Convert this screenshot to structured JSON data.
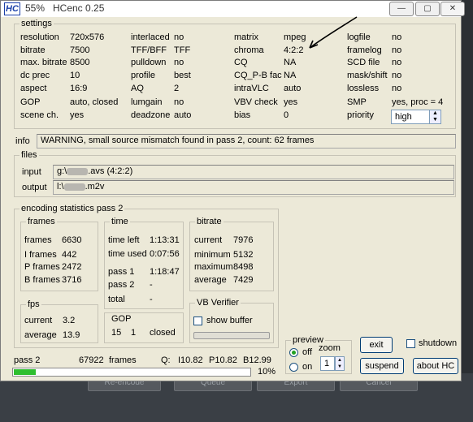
{
  "window": {
    "logo": "HC",
    "progress_title": "55%",
    "app_title": "HCenc 0.25",
    "buttons": {
      "minimize": "—",
      "maximize": "▢",
      "close": "✕"
    }
  },
  "taskbar": {
    "items": [
      "Re-encode",
      "Queue",
      "Export",
      "Cancel"
    ]
  },
  "settings": {
    "legend": "settings",
    "col1": [
      {
        "label": "resolution",
        "value": "720x576"
      },
      {
        "label": "bitrate",
        "value": "7500"
      },
      {
        "label": "max. bitrate",
        "value": "8500"
      },
      {
        "label": "dc prec",
        "value": "10"
      },
      {
        "label": "aspect",
        "value": "16:9"
      },
      {
        "label": "GOP",
        "value": "auto, closed"
      },
      {
        "label": "scene ch.",
        "value": "yes"
      }
    ],
    "col2": [
      {
        "label": "interlaced",
        "value": "no"
      },
      {
        "label": "TFF/BFF",
        "value": "TFF"
      },
      {
        "label": "pulldown",
        "value": "no"
      },
      {
        "label": "profile",
        "value": "best"
      },
      {
        "label": "AQ",
        "value": "2"
      },
      {
        "label": "lumgain",
        "value": "no"
      },
      {
        "label": "deadzone",
        "value": "auto"
      }
    ],
    "col3": [
      {
        "label": "matrix",
        "value": "mpeg"
      },
      {
        "label": "chroma",
        "value": "4:2:2"
      },
      {
        "label": "CQ",
        "value": "NA"
      },
      {
        "label": "CQ_P-B fac",
        "value": "NA"
      },
      {
        "label": "intraVLC",
        "value": "auto"
      },
      {
        "label": "VBV check",
        "value": "yes"
      },
      {
        "label": "bias",
        "value": "0"
      }
    ],
    "col4": [
      {
        "label": "logfile",
        "value": "no"
      },
      {
        "label": "framelog",
        "value": "no"
      },
      {
        "label": "SCD file",
        "value": "no"
      },
      {
        "label": "mask/shift",
        "value": "no"
      },
      {
        "label": "lossless",
        "value": "no"
      },
      {
        "label": "SMP",
        "value": "yes,  proc = 4"
      },
      {
        "label": "priority",
        "value": "high"
      }
    ]
  },
  "info": {
    "label": "info",
    "message": "WARNING, small source mismatch found in pass 2,  count: 62 frames"
  },
  "files": {
    "legend": "files",
    "input_label": "input",
    "input_prefix": "g:\\",
    "input_suffix": ".avs  (4:2:2)",
    "output_label": "output",
    "output_prefix": "l:\\",
    "output_suffix": ".m2v"
  },
  "stats": {
    "legend": "encoding statistics pass 2",
    "frames": {
      "legend": "frames",
      "rows": [
        {
          "label": "frames",
          "value": "6630"
        },
        {
          "label": "I frames",
          "value": "442"
        },
        {
          "label": "P frames",
          "value": "2472"
        },
        {
          "label": "B frames",
          "value": "3716"
        }
      ]
    },
    "time": {
      "legend": "time",
      "rows": [
        {
          "label": "time left",
          "value": "1:13:31"
        },
        {
          "label": "time used",
          "value": "0:07:56"
        },
        {
          "label": "pass 1",
          "value": "1:18:47"
        },
        {
          "label": "pass 2",
          "value": "-"
        },
        {
          "label": "total",
          "value": "-"
        }
      ]
    },
    "bitrate": {
      "legend": "bitrate",
      "rows": [
        {
          "label": "current",
          "value": "7976"
        },
        {
          "label": "minimum",
          "value": "5132"
        },
        {
          "label": "maximum",
          "value": "8498"
        },
        {
          "label": "average",
          "value": "7429"
        }
      ]
    },
    "fps": {
      "legend": "fps",
      "rows": [
        {
          "label": "current",
          "value": "3.2"
        },
        {
          "label": "average",
          "value": "13.9"
        }
      ]
    },
    "gop": {
      "legend": "GOP",
      "v1": "15",
      "v2": "1",
      "v3": "closed"
    },
    "vbv": {
      "legend": "VB Verifier",
      "show_buffer": "show buffer"
    }
  },
  "preview": {
    "legend": "preview",
    "off": "off",
    "on": "on",
    "zoom_label": "zoom",
    "zoom_value": "1"
  },
  "buttons": {
    "exit": "exit",
    "shutdown": "shutdown",
    "suspend": "suspend",
    "about": "about  HC"
  },
  "status": {
    "pass": "pass 2",
    "frames_count": "67922",
    "frames_label": "frames",
    "q_label": "Q:",
    "q_i": "I10.82",
    "q_p": "P10.82",
    "q_b": "B12.99",
    "percent": "10%",
    "progress_fraction": 0.1
  }
}
